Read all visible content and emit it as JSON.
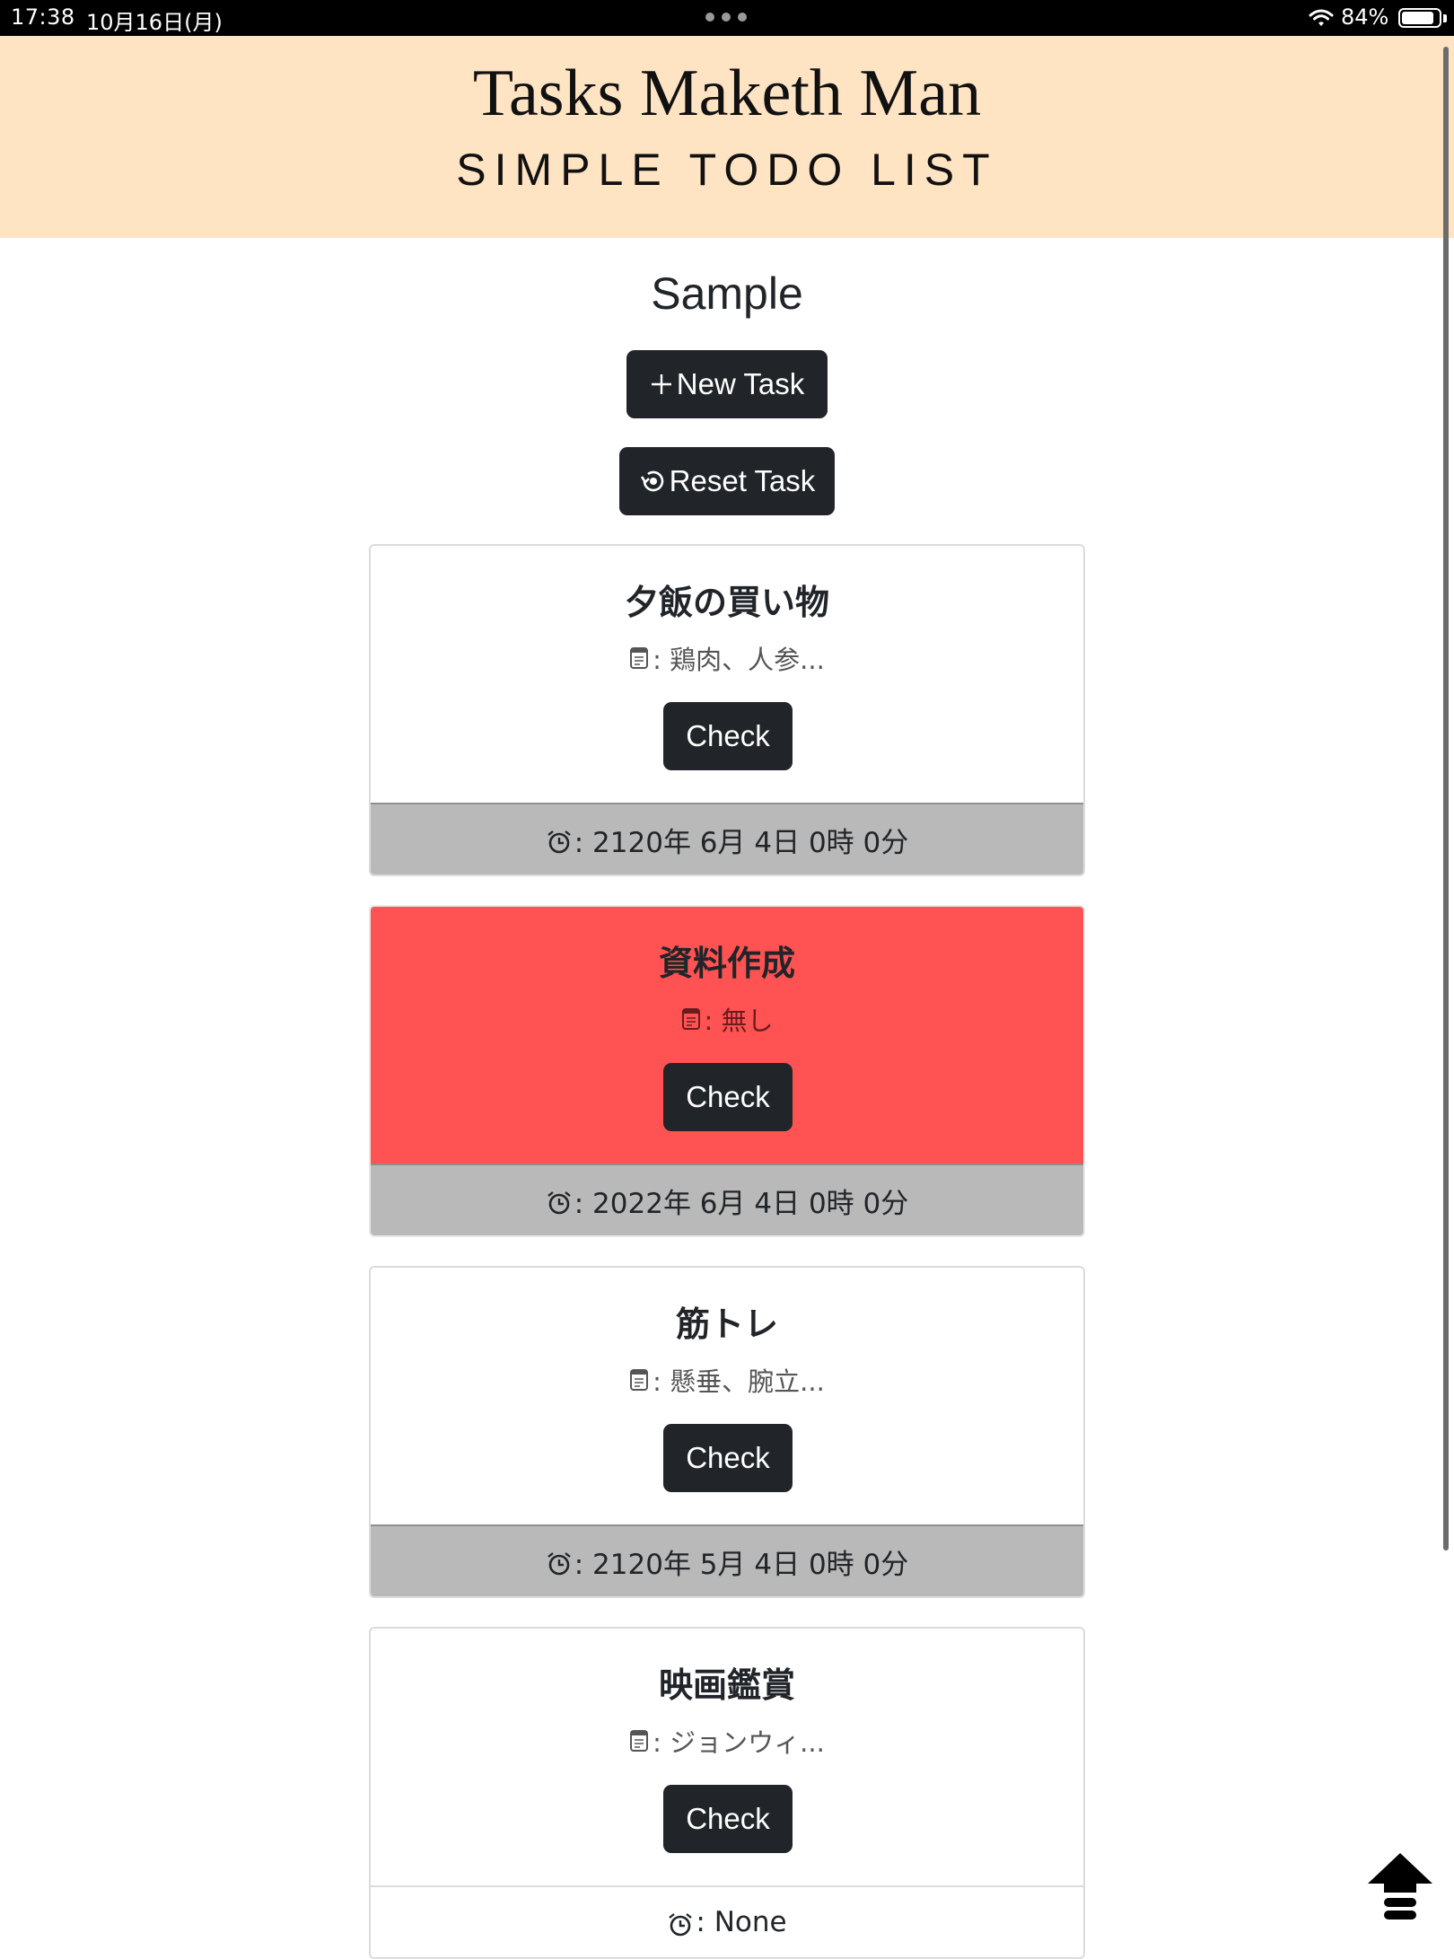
{
  "status_bar": {
    "time": "17:38",
    "date": "10月16日(月)",
    "battery": "84%"
  },
  "header": {
    "title": "Tasks Maketh Man",
    "subtitle": "SIMPLE TODO LIST",
    "background": "#ffe4c4"
  },
  "main": {
    "list_title": "Sample",
    "new_task_label": "New Task",
    "new_task_icon": "plus-icon",
    "reset_task_label": "Reset Task",
    "reset_task_icon": "reset-icon"
  },
  "tasks": [
    {
      "title": "夕飯の買い物",
      "memo": ": 鶏肉、人参...",
      "check_label": "Check",
      "deadline": ": 2120年 6月 4日 0時 0分",
      "overdue": false
    },
    {
      "title": "資料作成",
      "memo": ": 無し",
      "check_label": "Check",
      "deadline": ": 2022年 6月 4日 0時 0分",
      "overdue": true
    },
    {
      "title": "筋トレ",
      "memo": ": 懸垂、腕立...",
      "check_label": "Check",
      "deadline": ": 2120年 5月 4日 0時 0分",
      "overdue": false
    },
    {
      "title": "映画鑑賞",
      "memo": ": ジョンウィ...",
      "check_label": "Check",
      "deadline": ": None",
      "overdue": false
    }
  ],
  "colors": {
    "button": "#212529",
    "overdue": "#ff5252",
    "footer": "#b9b9b9"
  },
  "icons": {
    "memo": "memo-icon",
    "deadline": "alarm-clock-icon",
    "scroll_top": "arrow-up-icon"
  }
}
